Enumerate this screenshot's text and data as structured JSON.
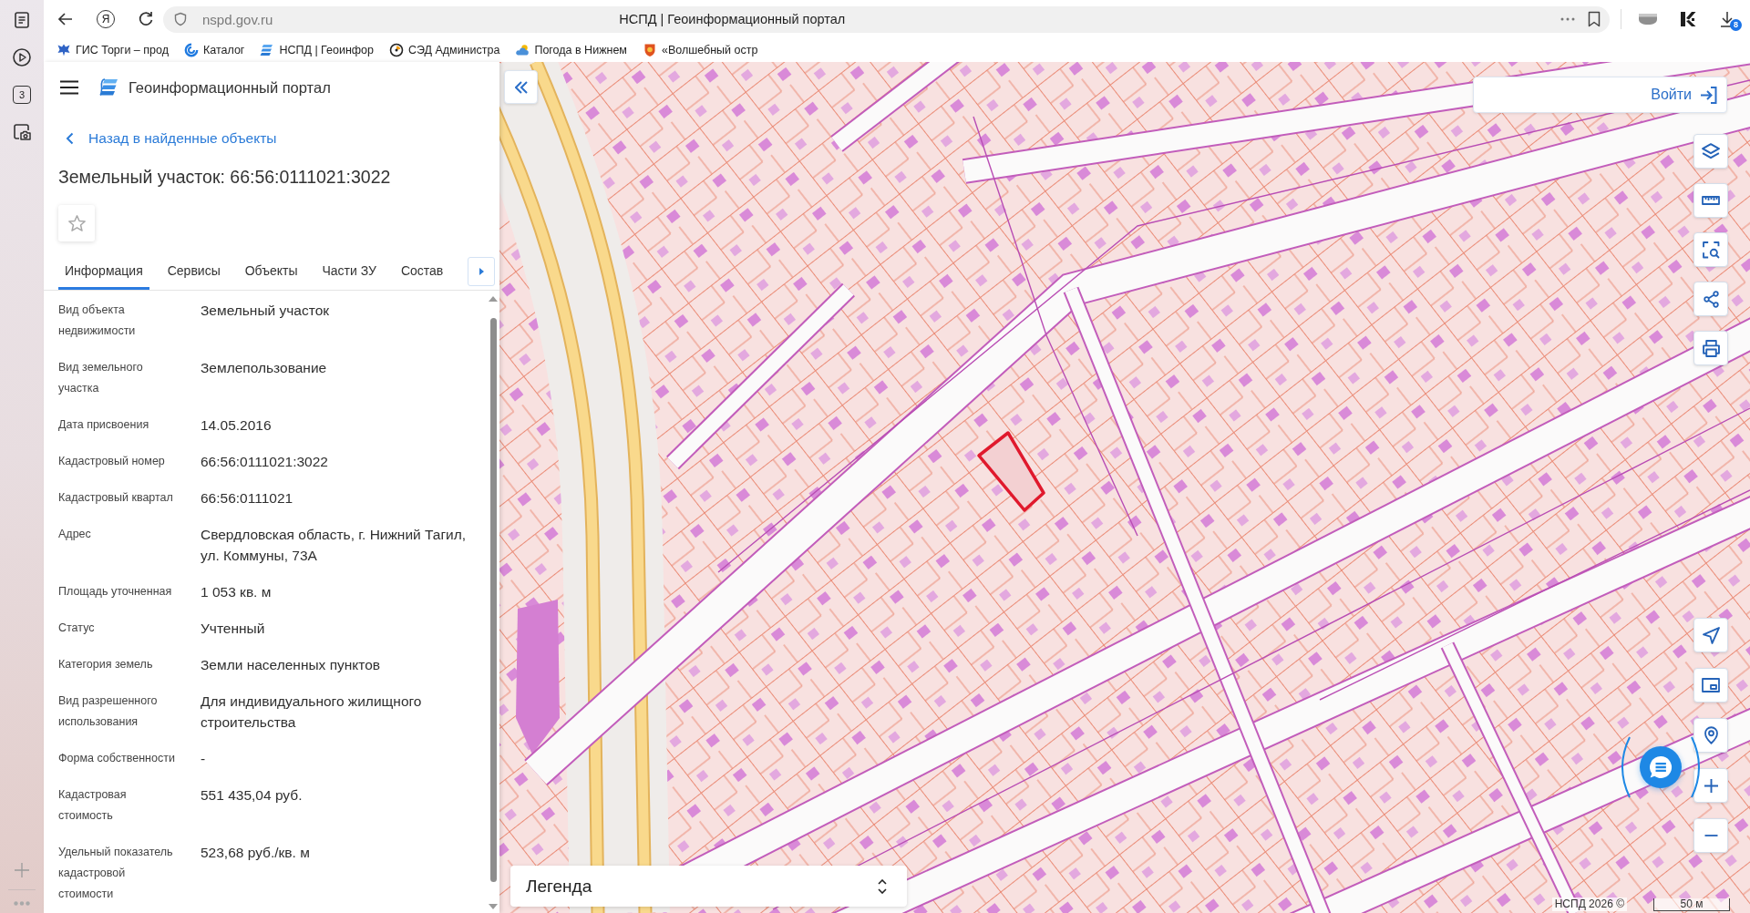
{
  "browser": {
    "side_panel": {
      "tab_count": "3"
    },
    "toolbar": {
      "home_button": "Я",
      "url": "nspd.gov.ru",
      "page_title": "НСПД | Геоинформационный портал",
      "downloads_badge": "8"
    },
    "bookmarks": [
      {
        "label": "ГИС Торги – прод",
        "kind": "emblem"
      },
      {
        "label": "Каталог",
        "kind": "ring"
      },
      {
        "label": "НСПД | Геоинфор",
        "kind": "layers"
      },
      {
        "label": "СЭД Администра",
        "kind": "dial"
      },
      {
        "label": "Погода в Нижнем",
        "kind": "weather"
      },
      {
        "label": "«Волшебный остр",
        "kind": "crest"
      }
    ]
  },
  "header": {
    "title": "Геоинформационный портал"
  },
  "object_card": {
    "back_link": "Назад в найденные объекты",
    "heading": "Земельный участок: 66:56:0111021:3022",
    "favorite": {
      "checked": false
    },
    "tabs": [
      {
        "label": "Информация",
        "selected": true
      },
      {
        "label": "Сервисы",
        "selected": false
      },
      {
        "label": "Объекты",
        "selected": false
      },
      {
        "label": "Части ЗУ",
        "selected": false
      },
      {
        "label": "Состав",
        "selected": false
      }
    ],
    "properties": [
      {
        "label": "Вид объекта недвижимости",
        "value": "Земельный участок"
      },
      {
        "label": "Вид земельного участка",
        "value": "Землепользование"
      },
      {
        "label": "Дата присвоения",
        "value": "14.05.2016"
      },
      {
        "label": "Кадастровый номер",
        "value": "66:56:0111021:3022"
      },
      {
        "label": "Кадастровый квартал",
        "value": "66:56:0111021"
      },
      {
        "label": "Адрес",
        "value": "Свердловская область, г. Нижний Тагил, ул. Коммуны, 73А"
      },
      {
        "label": "Площадь уточненная",
        "value": "1 053 кв. м"
      },
      {
        "label": "Статус",
        "value": "Учтенный"
      },
      {
        "label": "Категория земель",
        "value": "Земли населенных пунктов"
      },
      {
        "label": "Вид разрешенного использования",
        "value": "Для индивидуального жилищного строительства"
      },
      {
        "label": "Форма собственности",
        "value": "-"
      },
      {
        "label": "Кадастровая стоимость",
        "value": "551 435,04 руб."
      },
      {
        "label": "Удельный показатель кадастровой стоимости",
        "value": "523,68 руб./кв. м"
      }
    ]
  },
  "map": {
    "login_button": "Войти",
    "legend": "Легенда",
    "attribution": "НСПД 2026 ©",
    "scale": "50 м"
  }
}
